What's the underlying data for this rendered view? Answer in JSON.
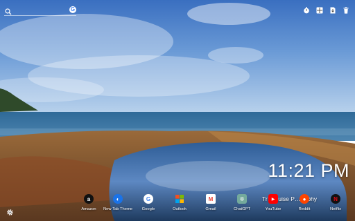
{
  "search": {
    "placeholder": "",
    "engine_icon": "google-g-icon",
    "engine_glyph": "G"
  },
  "top_toolbar": {
    "icons": [
      "timer-icon",
      "grid-icon",
      "download-icon",
      "trash-icon"
    ]
  },
  "clock": {
    "time": "11:21 PM"
  },
  "photo": {
    "title": "Tr… ouise P… raphy"
  },
  "dock": {
    "items": [
      {
        "label": "Amazon",
        "icon": "amazon-icon",
        "glyph": "a",
        "bg": "#111111",
        "fg": "#ffffff"
      },
      {
        "label": "New Tab Theme",
        "icon": "new-tab-theme-icon",
        "glyph": "◐",
        "bg": "#1a73e8",
        "fg": "#ffffff"
      },
      {
        "label": "Google",
        "icon": "google-icon",
        "glyph": "G",
        "bg": "#ffffff",
        "fg": "#4285f4"
      },
      {
        "label": "Outlook",
        "icon": "outlook-icon",
        "glyph": "▦",
        "bg": "transparent",
        "fg": "#f25022"
      },
      {
        "label": "Gmail",
        "icon": "gmail-icon",
        "glyph": "M",
        "bg": "#ffffff",
        "fg": "#ea4335"
      },
      {
        "label": "ChatGPT",
        "icon": "chatgpt-icon",
        "glyph": "✲",
        "bg": "#74aa9c",
        "fg": "#ffffff"
      },
      {
        "label": "YouTube",
        "icon": "youtube-icon",
        "glyph": "▶",
        "bg": "#ff0000",
        "fg": "#ffffff"
      },
      {
        "label": "Reddit",
        "icon": "reddit-icon",
        "glyph": "●",
        "bg": "#ff4500",
        "fg": "#ffffff"
      },
      {
        "label": "Netflix",
        "icon": "netflix-icon",
        "glyph": "N",
        "bg": "#111111",
        "fg": "#e50914"
      }
    ]
  },
  "settings": {
    "icon": "settings-gear-icon"
  }
}
